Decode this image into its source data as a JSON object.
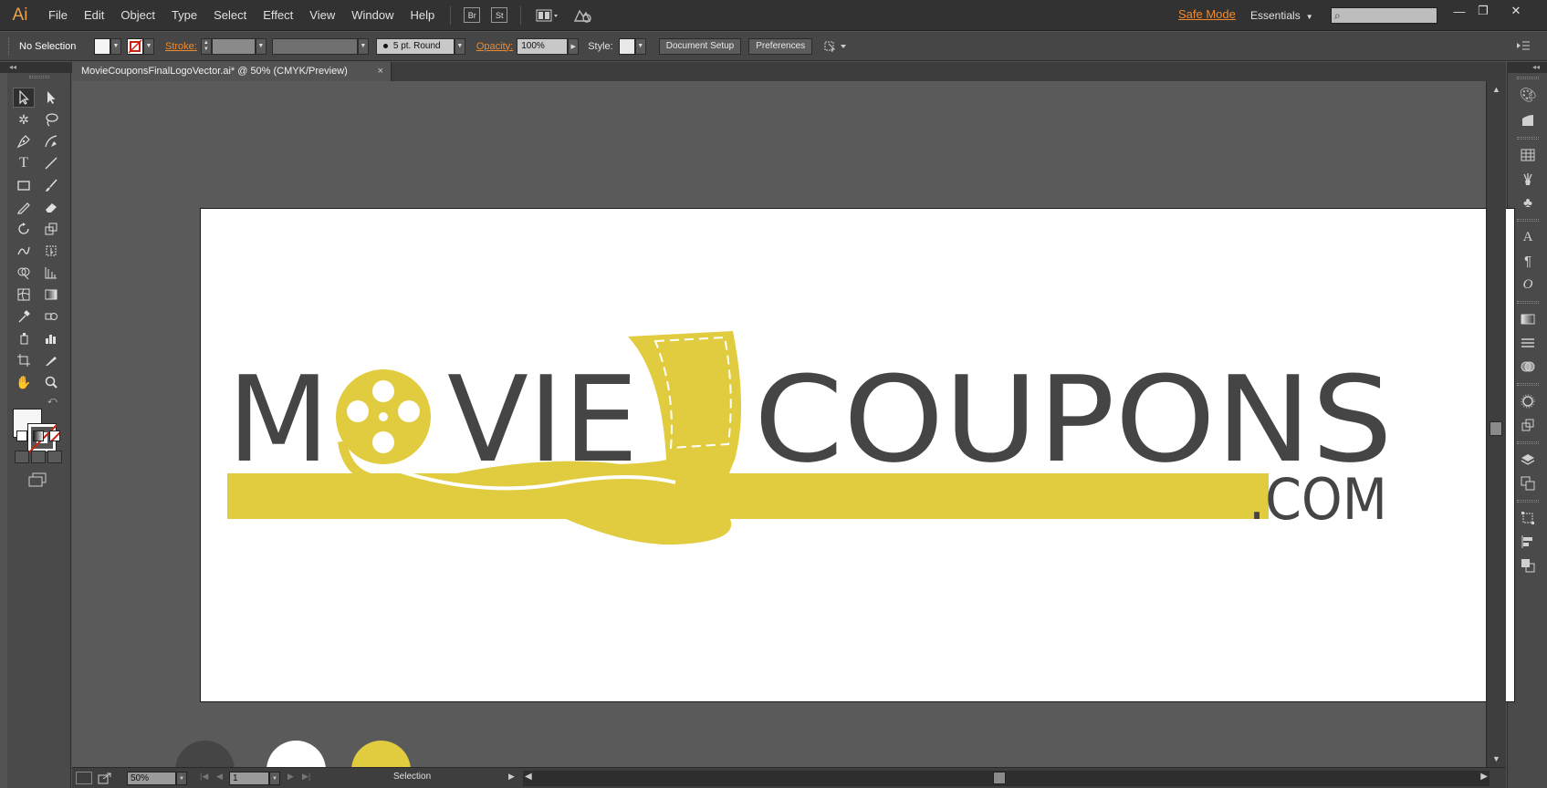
{
  "app": {
    "logo": "Ai"
  },
  "menu": [
    "File",
    "Edit",
    "Object",
    "Type",
    "Select",
    "Effect",
    "View",
    "Window",
    "Help"
  ],
  "menubar": {
    "bridge_label": "Br",
    "stock_label": "St",
    "safe_mode": "Safe Mode",
    "workspace": "Essentials",
    "search_placeholder": "",
    "window_controls": {
      "minimize": "—",
      "restore": "❐",
      "close": "✕"
    }
  },
  "control_bar": {
    "selection_label": "No Selection",
    "stroke_label": "Stroke:",
    "brush_label": "5 pt. Round",
    "opacity_label": "Opacity:",
    "opacity_value": "100%",
    "style_label": "Style:",
    "document_setup": "Document Setup",
    "preferences": "Preferences"
  },
  "document_tab": {
    "title": "MovieCouponsFinalLogoVector.ai* @ 50% (CMYK/Preview)",
    "close": "×"
  },
  "logo": {
    "word1": "M",
    "word1_rest": "VIE",
    "word2": "COUPONS",
    "suffix": ".COM"
  },
  "colors": {
    "dark_gray": "#454545",
    "white": "#ffffff",
    "yellow": "#e1cb3f",
    "orange_ui": "#ef8a2e"
  },
  "swatches": [
    {
      "color": "#454545"
    },
    {
      "color": "#ffffff"
    },
    {
      "color": "#e1cb3f"
    }
  ],
  "status_bar": {
    "zoom": "50%",
    "artboard_number": "1",
    "current_tool": "Selection"
  }
}
